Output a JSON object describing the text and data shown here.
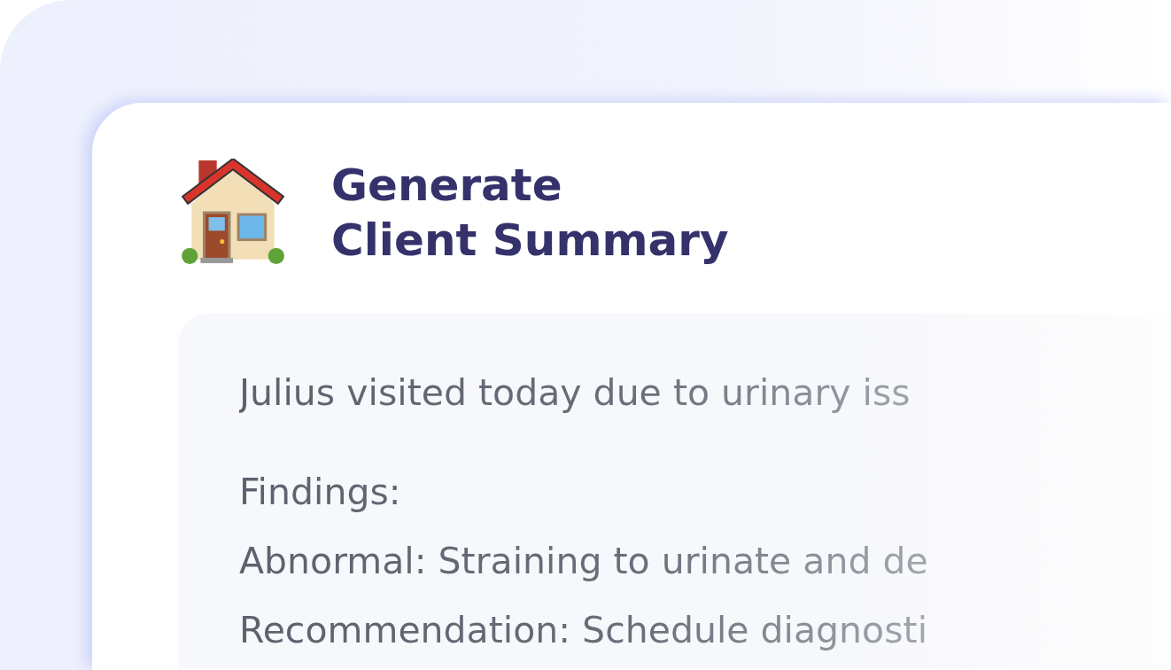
{
  "card": {
    "title_lines": [
      "Generate",
      "Client Summary"
    ]
  },
  "summary": {
    "intro": "Julius visited today due to urinary iss",
    "lines": [
      "Findings:",
      "Abnormal: Straining to urinate and de",
      "Recommendation: Schedule diagnosti"
    ]
  }
}
